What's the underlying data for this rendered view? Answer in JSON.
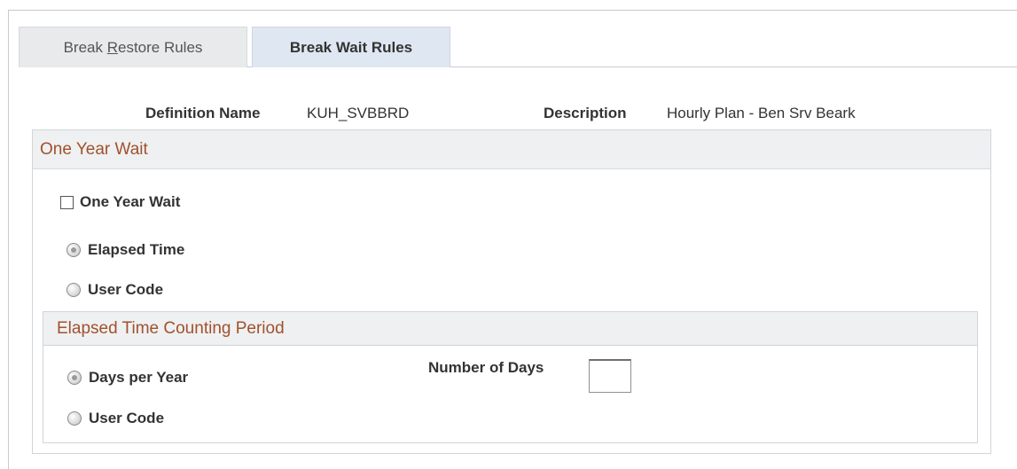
{
  "tabs": [
    {
      "label_pre": "Break ",
      "label_key": "R",
      "label_post": "estore Rules",
      "active": false
    },
    {
      "label": "Break Wait Rules",
      "active": true
    }
  ],
  "header": {
    "definition_name_label": "Definition Name",
    "definition_name_value": "KUH_SVBBRD",
    "description_label": "Description",
    "description_value": "Hourly Plan - Ben Srv Beark"
  },
  "one_year_wait_group": {
    "title": "One Year Wait",
    "checkbox_label": "One Year Wait",
    "checkbox_checked": false,
    "radio_elapsed_label": "Elapsed Time",
    "radio_user_code_label": "User Code",
    "selected": "Elapsed Time"
  },
  "counting_period_group": {
    "title": "Elapsed Time Counting Period",
    "radio_days_label": "Days per Year",
    "radio_user_code_label": "User Code",
    "selected": "Days per Year",
    "number_of_days_label": "Number of Days",
    "number_of_days_value": ""
  },
  "colors": {
    "group_title": "#a0522d",
    "active_tab_bg": "#dee7f2",
    "inactive_tab_bg": "#e9eaec"
  }
}
